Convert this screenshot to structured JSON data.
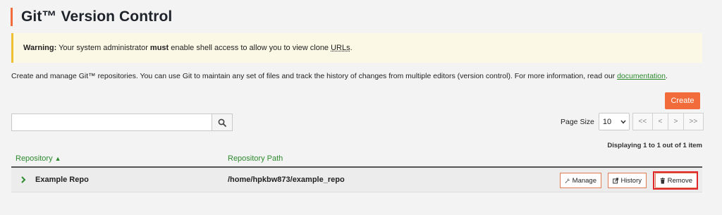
{
  "page": {
    "title": "Git™ Version Control"
  },
  "warning": {
    "label": "Warning:",
    "text_pre": " Your system administrator ",
    "emphasis": "must",
    "text_post": " enable shell access to allow you to view clone ",
    "urls": "URLs",
    "period": "."
  },
  "intro": {
    "text": "Create and manage Git™ repositories. You can use Git to maintain any set of files and track the history of changes from multiple editors (version control). For more information, read our ",
    "link": "documentation",
    "period": "."
  },
  "toolbar": {
    "create_label": "Create",
    "search_value": "",
    "search_icon": "search-icon"
  },
  "pager": {
    "page_size_label": "Page Size",
    "page_size_value": "10",
    "first": "<<",
    "prev": "<",
    "next": ">",
    "last": ">>",
    "displaying": "Displaying 1 to 1 out of 1 item"
  },
  "table": {
    "columns": [
      {
        "label": "Repository",
        "sort": "▲"
      },
      {
        "label": "Repository Path"
      }
    ],
    "rows": [
      {
        "name": "Example Repo",
        "path": "/home/hpkbw873/example_repo",
        "actions": {
          "manage": "Manage",
          "history": "History",
          "remove": "Remove"
        }
      }
    ]
  },
  "colors": {
    "accent": "#f26b3a",
    "link_green": "#2d8a2d",
    "warning_bg": "#fcf8e6",
    "highlight_red": "#e0262b"
  }
}
